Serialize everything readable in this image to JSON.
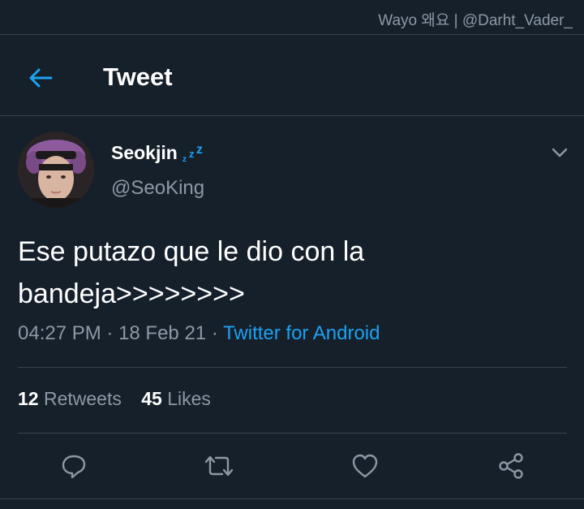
{
  "watermark": "Wayo 왜요 | @Darht_Vader_",
  "header": {
    "back_icon": "arrow-left-icon",
    "title": "Tweet"
  },
  "tweet": {
    "author": {
      "display_name": "Seokjin",
      "display_name_emoji": "zzz-icon",
      "handle": "@SeoKing"
    },
    "text": "Ese putazo que le dio con la\nbandeja>>>>>>>>",
    "time": "04:27 PM",
    "separator": " · ",
    "date": "18 Feb 21",
    "source": "Twitter for Android"
  },
  "stats": {
    "retweets_count": "12",
    "retweets_label": "Retweets",
    "likes_count": "45",
    "likes_label": "Likes"
  },
  "actions": [
    "reply-icon",
    "retweet-icon",
    "like-icon",
    "share-icon"
  ],
  "colors": {
    "background": "#15202b",
    "accent": "#1da1f2",
    "secondary_text": "#8d98a4",
    "divider": "#38444d"
  }
}
